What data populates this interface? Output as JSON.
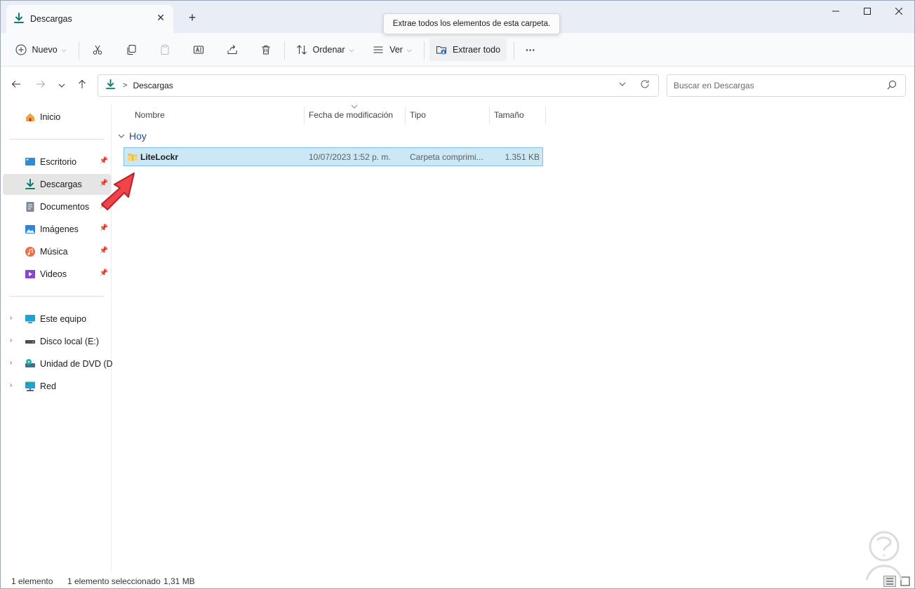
{
  "window": {
    "tab_title": "Descargas",
    "tab_close": "✕",
    "new_tab": "+",
    "minimize": "—",
    "maximize": "☐",
    "close": "✕"
  },
  "toolbar": {
    "new_label": "Nuevo",
    "sort_label": "Ordenar",
    "view_label": "Ver",
    "extract_label": "Extraer todo",
    "more_label": "···",
    "tooltip": "Extrae todos los elementos de esta carpeta."
  },
  "address": {
    "crumb": "Descargas",
    "crumb_sep": ">",
    "search_placeholder": "Buscar en Descargas"
  },
  "sidebar": {
    "home": "Inicio",
    "quick": [
      {
        "label": "Escritorio",
        "icon": "desktop-icon",
        "pinned": true
      },
      {
        "label": "Descargas",
        "icon": "download-icon",
        "pinned": true,
        "active": true
      },
      {
        "label": "Documentos",
        "icon": "document-icon",
        "pinned": true
      },
      {
        "label": "Imágenes",
        "icon": "pictures-icon",
        "pinned": true
      },
      {
        "label": "Música",
        "icon": "music-icon",
        "pinned": true
      },
      {
        "label": "Videos",
        "icon": "videos-icon",
        "pinned": true
      }
    ],
    "devices": [
      {
        "label": "Este equipo",
        "icon": "computer-icon"
      },
      {
        "label": "Disco local (E:)",
        "icon": "drive-icon"
      },
      {
        "label": "Unidad de DVD (D:)",
        "icon": "dvd-icon"
      },
      {
        "label": "Red",
        "icon": "network-icon"
      }
    ]
  },
  "list": {
    "columns": [
      "Nombre",
      "Fecha de modificación",
      "Tipo",
      "Tamaño"
    ],
    "group": "Hoy",
    "rows": [
      {
        "name": "LiteLockr",
        "date": "10/07/2023 1:52 p. m.",
        "type": "Carpeta comprimi...",
        "size": "1.351 KB",
        "selected": true
      }
    ]
  },
  "status": {
    "count": "1 elemento",
    "selection": "1 elemento seleccionado",
    "size": "1,31 MB"
  },
  "colors": {
    "accent": "#0f7b6c",
    "selection_bg": "#cce8f6",
    "selection_border": "#7ec3e6",
    "arrow": "#f0434a"
  }
}
